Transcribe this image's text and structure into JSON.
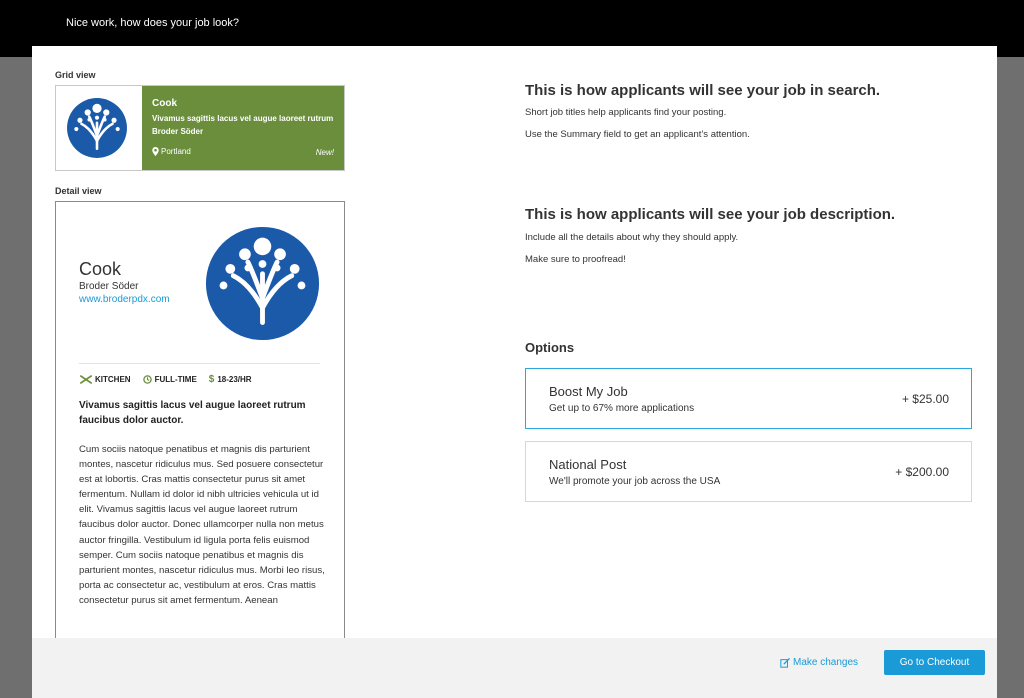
{
  "header": {
    "title": "Nice work, how does your job look?"
  },
  "grid_view": {
    "label": "Grid view",
    "title": "Cook",
    "summary": "Vivamus sagittis lacus vel augue laoreet rutrum",
    "company": "Broder Söder",
    "location": "Portland",
    "badge": "New!",
    "color": "#6a8e3c"
  },
  "detail_view": {
    "label": "Detail view",
    "title": "Cook",
    "company": "Broder Söder",
    "url": "www.broderpdx.com",
    "tags": [
      {
        "icon": "kitchen-icon",
        "label": "KITCHEN"
      },
      {
        "icon": "clock-icon",
        "label": "FULL-TIME"
      },
      {
        "icon": "dollar-icon",
        "label": "18-23/HR"
      }
    ],
    "lead": "Vivamus sagittis lacus vel augue laoreet rutrum faucibus dolor auctor.",
    "body": "Cum sociis natoque penatibus et magnis dis parturient montes, nascetur ridiculus mus. Sed posuere consectetur est at lobortis. Cras mattis consectetur purus sit amet fermentum. Nullam id dolor id nibh ultricies vehicula ut id elit. Vivamus sagittis lacus vel augue laoreet rutrum faucibus dolor auctor.  Donec ullamcorper nulla non metus auctor fringilla. Vestibulum id ligula porta felis euismod semper. Cum sociis natoque penatibus et magnis dis parturient montes, nascetur ridiculus mus. Morbi leo risus, porta ac consectetur ac, vestibulum at eros.  Cras mattis consectetur purus sit amet fermentum. Aenean"
  },
  "search_info": {
    "heading": "This is how applicants will see your job in search.",
    "line1": "Short job titles help applicants find your posting.",
    "line2": "Use the Summary field to get an applicant’s attention."
  },
  "description_info": {
    "heading": "This is how applicants will see your job description.",
    "line1": "Include all the details about why they should apply.",
    "line2": "Make sure to proofread!"
  },
  "options": {
    "title": "Options",
    "items": [
      {
        "name": "Boost My Job",
        "desc": "Get up to 67% more applications",
        "price": "+ $25.00",
        "selected": true
      },
      {
        "name": "National Post",
        "desc": "We'll promote your job across the USA",
        "price": "+ $200.00",
        "selected": false
      }
    ]
  },
  "footer": {
    "make_changes": "Make changes",
    "checkout": "Go to Checkout"
  },
  "colors": {
    "brand_blue": "#1a5aa8",
    "accent_blue": "#1a9ad6",
    "grid_green": "#6a8e3c"
  }
}
